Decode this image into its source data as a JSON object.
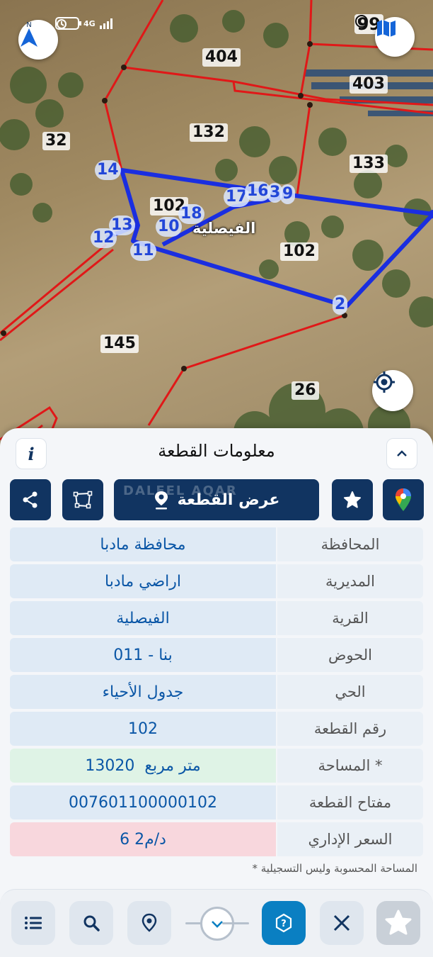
{
  "status_bar": {
    "network": "4G",
    "notifications": "99"
  },
  "map": {
    "plot_labels": [
      "404",
      "403",
      "32",
      "132",
      "133",
      "102",
      "102",
      "145",
      "26"
    ],
    "vertex_labels": [
      "14",
      "13",
      "12",
      "11",
      "10",
      "18",
      "17",
      "16",
      "3",
      "9",
      "2"
    ],
    "village_label": "الفيصلية"
  },
  "panel": {
    "title": "معلومات القطعة",
    "show_plot_button": "عرض القطعة",
    "watermark": "DALEEL AQAR",
    "rows": [
      {
        "label": "المحافظة",
        "value": "محافظة مادبا"
      },
      {
        "label": "المديرية",
        "value": "اراضي مادبا"
      },
      {
        "label": "القرية",
        "value": "الفيصلية"
      },
      {
        "label": "الحوض",
        "value": "بنا - 011"
      },
      {
        "label": "الحي",
        "value": "جدول الأحياء"
      },
      {
        "label": "رقم القطعة",
        "value": "102"
      },
      {
        "label": "المساحة *",
        "value": "13020  متر مربع"
      },
      {
        "label": "مفتاح القطعة",
        "value": "007601100000102"
      },
      {
        "label": "السعر الإداري",
        "value": "6 د/م2"
      }
    ],
    "footnote": "* المساحة المحسوبة وليس التسجيلية"
  },
  "colors": {
    "primary": "#113461",
    "accent": "#0a7fc2",
    "value_text": "#0a56a6",
    "parcel_red": "#e01818",
    "parcel_blue": "#1a2ee0"
  }
}
